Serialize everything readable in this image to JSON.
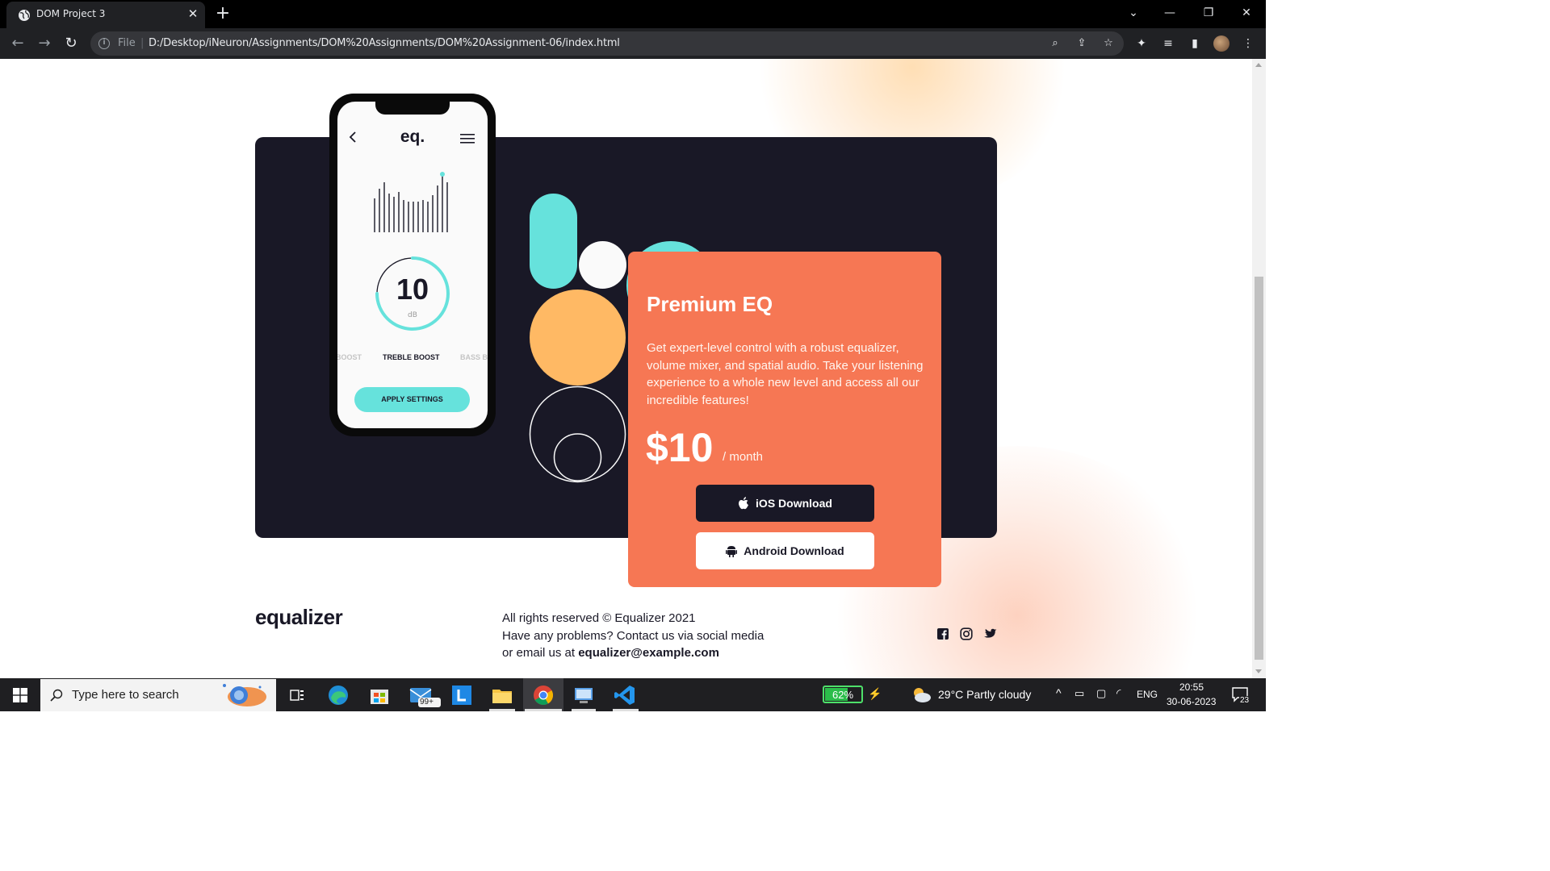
{
  "browser": {
    "tab_title": "DOM Project 3",
    "file_label": "File",
    "url": "D:/Desktop/iNeuron/Assignments/DOM%20Assignments/DOM%20Assignment-06/index.html"
  },
  "phone": {
    "logo": "eq.",
    "dial_value": "10",
    "dial_unit": "dB",
    "presets": [
      "BOOST",
      "TREBLE BOOST",
      "BASS B"
    ],
    "apply_label": "APPLY SETTINGS"
  },
  "card": {
    "title": "Premium EQ",
    "description": "Get expert-level control with a robust equalizer, volume mixer, and spatial audio. Take your listening experience to a whole new level and access all our incredible features!",
    "price": "$10",
    "period": "/ month",
    "ios_label": "iOS Download",
    "android_label": "Android Download"
  },
  "footer": {
    "logo": "equalizer",
    "line1": "All rights reserved © Equalizer 2021",
    "line2": "Have any problems? Contact us via social media",
    "line3_prefix": "or email us at",
    "email": "equalizer@example.com",
    "social_icons": [
      "facebook-icon",
      "instagram-icon",
      "twitter-icon"
    ]
  },
  "colors": {
    "dark": "#191826",
    "orange": "#f67754",
    "cyan": "#66e2dc",
    "yellow": "#ffb964",
    "cream": "#fafafa"
  },
  "taskbar": {
    "search_placeholder": "Type here to search",
    "mail_badge": "99+",
    "battery": "62%",
    "weather": "29°C  Partly cloudy",
    "language": "ENG",
    "time": "20:55",
    "date": "30-06-2023",
    "notifications": "23"
  }
}
